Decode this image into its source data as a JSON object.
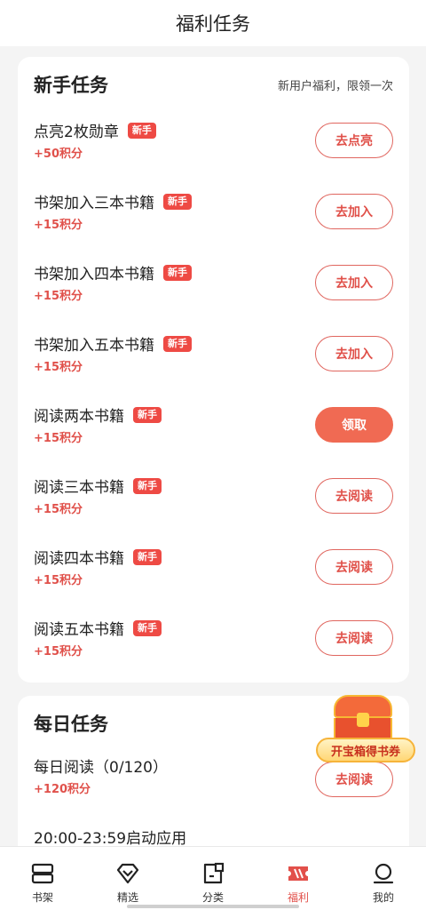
{
  "header": {
    "title": "福利任务"
  },
  "new_tasks": {
    "title": "新手任务",
    "note": "新用户福利，限领一次",
    "items": [
      {
        "name": "点亮2枚勋章",
        "badge": "新手",
        "points": "+50积分",
        "action": "去点亮",
        "style": "outline"
      },
      {
        "name": "书架加入三本书籍",
        "badge": "新手",
        "points": "+15积分",
        "action": "去加入",
        "style": "outline"
      },
      {
        "name": "书架加入四本书籍",
        "badge": "新手",
        "points": "+15积分",
        "action": "去加入",
        "style": "outline"
      },
      {
        "name": "书架加入五本书籍",
        "badge": "新手",
        "points": "+15积分",
        "action": "去加入",
        "style": "outline"
      },
      {
        "name": "阅读两本书籍",
        "badge": "新手",
        "points": "+15积分",
        "action": "领取",
        "style": "filled"
      },
      {
        "name": "阅读三本书籍",
        "badge": "新手",
        "points": "+15积分",
        "action": "去阅读",
        "style": "outline"
      },
      {
        "name": "阅读四本书籍",
        "badge": "新手",
        "points": "+15积分",
        "action": "去阅读",
        "style": "outline"
      },
      {
        "name": "阅读五本书籍",
        "badge": "新手",
        "points": "+15积分",
        "action": "去阅读",
        "style": "outline"
      }
    ]
  },
  "daily_tasks": {
    "title": "每日任务",
    "items": [
      {
        "name": "每日阅读（0/120）",
        "points": "+120积分",
        "action": "去阅读"
      },
      {
        "name": "20:00-23:59启动应用"
      }
    ]
  },
  "treasure": {
    "label": "开宝箱得书券",
    "icon": "treasure-chest-icon"
  },
  "tabbar": {
    "items": [
      {
        "label": "书架",
        "icon": "bookshelf-icon",
        "active": false
      },
      {
        "label": "精选",
        "icon": "diamond-icon",
        "active": false
      },
      {
        "label": "分类",
        "icon": "category-icon",
        "active": false
      },
      {
        "label": "福利",
        "icon": "ticket-icon",
        "active": true
      },
      {
        "label": "我的",
        "icon": "profile-icon",
        "active": false
      }
    ]
  },
  "colors": {
    "accent": "#e2504a",
    "button_filled": "#f06a53",
    "badge": "#ee4a44",
    "background": "#f4f4f4"
  }
}
